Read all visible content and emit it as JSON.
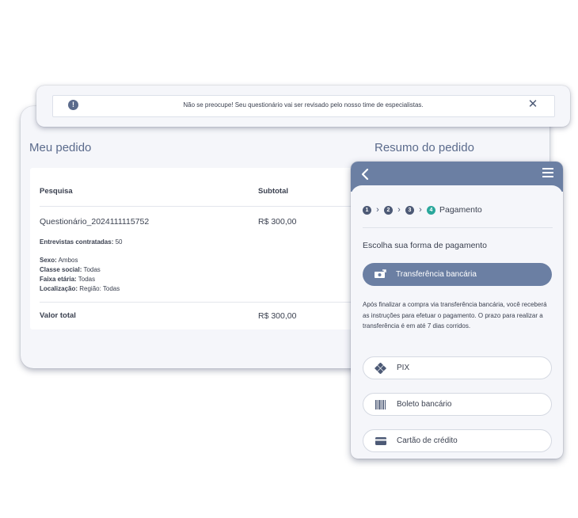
{
  "notification": {
    "message": "Não se preocupe! Seu questionário vai ser revisado pelo nosso time de especialistas.",
    "info_icon": "!",
    "close_icon": "✕"
  },
  "order": {
    "title": "Meu pedido",
    "summary_title": "Resumo do pedido",
    "col_research": "Pesquisa",
    "col_subtotal": "Subtotal",
    "item_name": "Questionário_2024111115752",
    "item_price": "R$ 300,00",
    "details": [
      {
        "label": "Entrevistas contratadas:",
        "value": " 50"
      },
      {
        "label": "Sexo:",
        "value": " Ambos"
      },
      {
        "label": "Classe social:",
        "value": " Todas"
      },
      {
        "label": "Faixa etária:",
        "value": " Todas"
      },
      {
        "label": "Localização:",
        "value": " Região: Todas"
      }
    ],
    "total_label": "Valor total",
    "total_value": "R$ 300,00"
  },
  "payment": {
    "steps": [
      "1",
      "2",
      "3",
      "4"
    ],
    "current_step_label": "Pagamento",
    "choose_title": "Escolha sua forma de pagamento",
    "selected_method": {
      "label": "Transferência bancária",
      "icon": "bank-transfer-icon"
    },
    "description": "Após finalizar a compra via transferência bancária, você receberá as instruções para efetuar o pagamento. O prazo para realizar a transferência é em até 7 dias corridos.",
    "options": [
      {
        "label": "PIX",
        "icon": "pix-icon"
      },
      {
        "label": "Boleto bancário",
        "icon": "barcode-icon"
      },
      {
        "label": "Cartão de crédito",
        "icon": "credit-card-icon"
      }
    ]
  },
  "colors": {
    "accent": "#6b7fa3",
    "dark_slate": "#4d5a76",
    "step_active": "#2aa79b",
    "panel_bg": "#f5f6fa"
  }
}
